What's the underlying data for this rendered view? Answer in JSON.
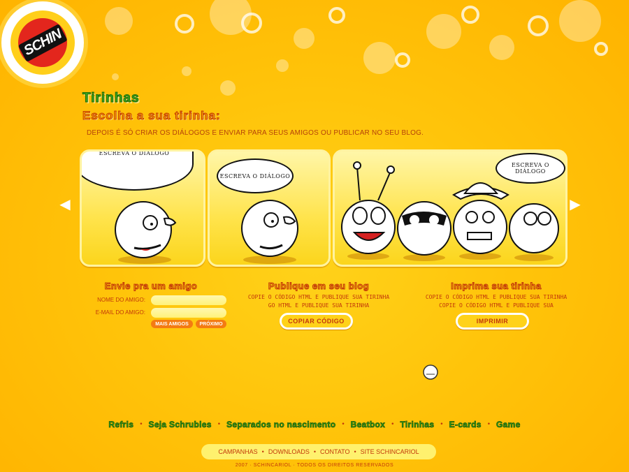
{
  "brand": {
    "logo_text": "SCHIN"
  },
  "header": {
    "title": "Tirinhas",
    "subtitle": "Escolha a sua tirinha:",
    "intro": "DEPOIS É SÓ CRIAR OS DIÁLOGOS E ENVIAR PARA SEUS AMIGOS OU PUBLICAR NO SEU BLOG."
  },
  "strip": {
    "prev_icon": "arrow-left-icon",
    "next_icon": "arrow-right-icon",
    "panels": [
      {
        "speech": "ESCREVA O DIÁLOGO"
      },
      {
        "speech": "ESCREVA O DIÁLOGO"
      },
      {
        "speech": "ESCREVA O DIÁLOGO"
      }
    ]
  },
  "send": {
    "heading": "Envie pra um amigo",
    "name_label": "NOME DO AMIGO:",
    "email_label": "E-MAIL DO AMIGO:",
    "name_value": "",
    "email_value": "",
    "more_friends": "MAIS AMIGOS",
    "next": "PRÓXIMO"
  },
  "publish": {
    "heading": "Publique em seu blog",
    "line1": "COPIE O CÓDIGO HTML E PUBLIQUE SUA TIRINHA",
    "line2": "GO HTML E PUBLIQUE SUA TIRINHA",
    "button": "COPIAR CÓDIGO"
  },
  "print": {
    "heading": "Imprima sua tirinha",
    "line1": "COPIE O CÓDIGO HTML E PUBLIQUE SUA TIRINHA",
    "line2": "COPIE O CÓDIGO HTML E PUBLIQUE SUA",
    "button": "IMPRIMIR"
  },
  "nav": [
    "Refris",
    "Seja Schrubles",
    "Separados no nascimento",
    "Beatbox",
    "Tirinhas",
    "E-cards",
    "Game"
  ],
  "footer_links": [
    "CAMPANHAS",
    "DOWNLOADS",
    "CONTATO",
    "SITE SCHINCARIOL"
  ],
  "copyright": "2007 · SCHINCARIOL · TODOS OS DIREITOS RESERVADOS",
  "colors": {
    "background": "#ffc40a",
    "nav_green": "#38a317",
    "accent_red": "#c2370b",
    "button_orange": "#f47b12"
  }
}
